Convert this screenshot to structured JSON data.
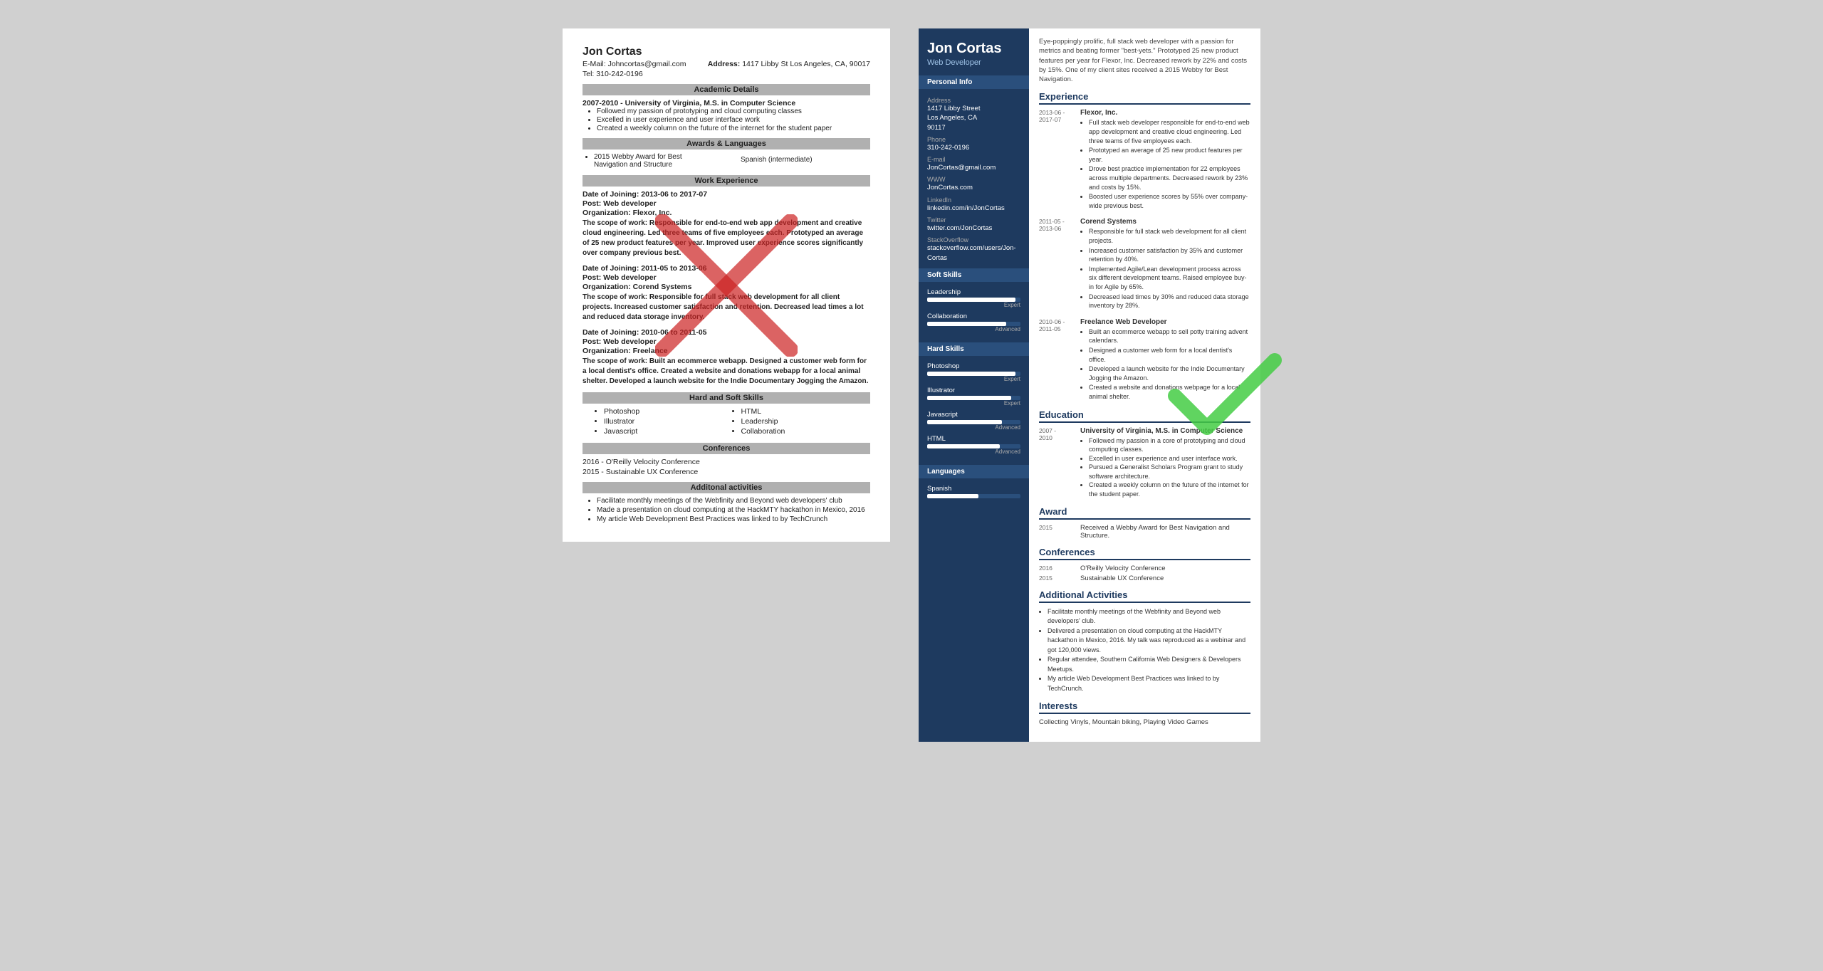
{
  "left_resume": {
    "name": "Jon Cortas",
    "email_label": "E-Mail:",
    "email": "Johncortas@gmail.com",
    "address_label": "Address:",
    "address": "1417 Libby St Los Angeles, CA, 90017",
    "tel_label": "Tel:",
    "tel": "310-242-0196",
    "sections": {
      "academic": "Academic Details",
      "awards": "Awards & Languages",
      "work": "Work Experience",
      "skills": "Hard and Soft Skills",
      "conferences": "Conferences",
      "activities": "Additonal activities"
    },
    "education": {
      "dates": "2007-2010 -",
      "degree": "University of Virginia, M.S. in Computer Science",
      "bullets": [
        "Followed my passion of prototyping and cloud computing classes",
        "Excelled in user experience and user interface work",
        "Created a weekly column on the future of the internet for the student paper"
      ]
    },
    "awards": {
      "left": "2015 Webby Award for Best Navigation and Structure",
      "right": "Spanish (intermediate)"
    },
    "work_entries": [
      {
        "date_label": "Date of Joining:",
        "date": "2013-06 to 2017-07",
        "post_label": "Post:",
        "post": "Web developer",
        "org_label": "Organization:",
        "org": "Flexor, Inc.",
        "scope_label": "The scope of work:",
        "scope": "Responsible for end-to-end web app development and creative cloud engineering. Led three teams of five employees each. Prototyped an average of 25 new product features per year. Improved user experience scores significantly over company previous best."
      },
      {
        "date_label": "Date of Joining:",
        "date": "2011-05 to 2013-06",
        "post_label": "Post:",
        "post": "Web developer",
        "org_label": "Organization:",
        "org": "Corend Systems",
        "scope_label": "The scope of work:",
        "scope": "Responsible for full stack web development for all client projects. Increased customer satisfaction and retention. Decreased lead times a lot and reduced data storage inventory."
      },
      {
        "date_label": "Date of Joining:",
        "date": "2010-06 to 2011-05",
        "post_label": "Post:",
        "post": "Web developer",
        "org_label": "Organization:",
        "org": "Freelance",
        "scope_label": "The scope of work:",
        "scope": "Built an ecommerce webapp. Designed a customer web form for a local dentist's office. Created a website and donations webapp for a local animal shelter. Developed a launch website for the Indie Documentary Jogging the Amazon."
      }
    ],
    "skills": [
      "Photoshop",
      "Illustrator",
      "Javascript",
      "HTML",
      "Leadership",
      "Collaboration"
    ],
    "conferences": [
      "2016 - O'Reilly Velocity Conference",
      "2015 - Sustainable UX Conference"
    ],
    "activities": [
      "Facilitate monthly meetings of the Webfinity and Beyond web developers' club",
      "Made a presentation on cloud computing at the HackMTY hackathon in Mexico, 2016",
      "My article Web Development Best Practices was linked to by TechCrunch"
    ]
  },
  "right_resume": {
    "name": "Jon Cortas",
    "title": "Web Developer",
    "intro": "Eye-poppingly prolific, full stack web developer with a passion for metrics and beating former \"best-yets.\" Prototyped 25 new product features per year for Flexor, Inc. Decreased rework by 22% and costs by 15%. One of my client sites received a 2015 Webby for Best Navigation.",
    "sidebar": {
      "personal_section": "Personal Info",
      "address_label": "Address",
      "address_lines": [
        "1417 Libby Street",
        "Los Angeles, CA",
        "90117"
      ],
      "phone_label": "Phone",
      "phone": "310-242-0196",
      "email_label": "E-mail",
      "email": "JonCortas@gmail.com",
      "www_label": "WWW",
      "www": "JonCortas.com",
      "linkedin_label": "LinkedIn",
      "linkedin": "linkedin.com/in/JonCortas",
      "twitter_label": "Twitter",
      "twitter": "twitter.com/JonCortas",
      "stackoverflow_label": "StackOverflow",
      "stackoverflow": "stackoverflow.com/users/Jon-Cortas",
      "soft_skills_section": "Soft Skills",
      "soft_skills": [
        {
          "name": "Leadership",
          "level": "Expert",
          "pct": 95
        },
        {
          "name": "Collaboration",
          "level": "Advanced",
          "pct": 85
        }
      ],
      "hard_skills_section": "Hard Skills",
      "hard_skills": [
        {
          "name": "Photoshop",
          "level": "Expert",
          "pct": 95
        },
        {
          "name": "Illustrator",
          "level": "Expert",
          "pct": 90
        },
        {
          "name": "Javascript",
          "level": "Advanced",
          "pct": 80
        },
        {
          "name": "HTML",
          "level": "Advanced",
          "pct": 78
        }
      ],
      "languages_section": "Languages",
      "languages": [
        {
          "name": "Spanish",
          "level": "",
          "pct": 55
        }
      ]
    },
    "experience_section": "Experience",
    "experience": [
      {
        "dates": "2013-06 -\n2017-07",
        "company": "Flexor, Inc.",
        "bullets": [
          "Full stack web developer responsible for end-to-end web app development and creative cloud engineering. Led three teams of five employees each.",
          "Prototyped an average of 25 new product features per year.",
          "Drove best practice implementation for 22 employees across multiple departments. Decreased rework by 23% and costs by 15%.",
          "Boosted user experience scores by 55% over company-wide previous best."
        ]
      },
      {
        "dates": "2011-05 -\n2013-06",
        "company": "Corend Systems",
        "bullets": [
          "Responsible for full stack web development for all client projects.",
          "Increased customer satisfaction by 35% and customer retention by 40%.",
          "Implemented Agile/Lean development process across six different development teams. Raised employee buy-in for Agile by 65%.",
          "Decreased lead times by 30% and reduced data storage inventory by 28%."
        ]
      },
      {
        "dates": "2010-06 -\n2011-05",
        "company": "Freelance Web Developer",
        "bullets": [
          "Built an ecommerce webapp to sell potty training advent calendars.",
          "Designed a customer web form for a local dentist's office.",
          "Developed a launch website for the Indie Documentary Jogging the Amazon.",
          "Created a website and donations webpage for a local animal shelter."
        ]
      }
    ],
    "education_section": "Education",
    "education": [
      {
        "dates": "2007 -\n2010",
        "school": "University of Virginia, M.S. in Computer Science",
        "bullets": [
          "Followed my passion in a core of prototyping and cloud computing classes.",
          "Excelled in user experience and user interface work.",
          "Pursued a Generalist Scholars Program grant to study software architecture.",
          "Created a weekly column on the future of the internet for the student paper."
        ]
      }
    ],
    "award_section": "Award",
    "awards": [
      {
        "year": "2015",
        "text": "Received a Webby Award for Best Navigation and Structure."
      }
    ],
    "conferences_section": "Conferences",
    "conferences": [
      {
        "year": "2016",
        "name": "O'Reilly Velocity Conference"
      },
      {
        "year": "2015",
        "name": "Sustainable UX Conference"
      }
    ],
    "activities_section": "Additional Activities",
    "activities": [
      "Facilitate monthly meetings of the Webfinity and Beyond web developers' club.",
      "Delivered a presentation on cloud computing at the HackMTY hackathon in Mexico, 2016. My talk was reproduced as a webinar and got 120,000 views.",
      "Regular attendee, Southern California Web Designers & Developers Meetups.",
      "My article Web Development Best Practices was linked to by TechCrunch."
    ],
    "interests_section": "Interests",
    "interests": "Collecting Vinyls, Mountain biking, Playing Video Games"
  }
}
